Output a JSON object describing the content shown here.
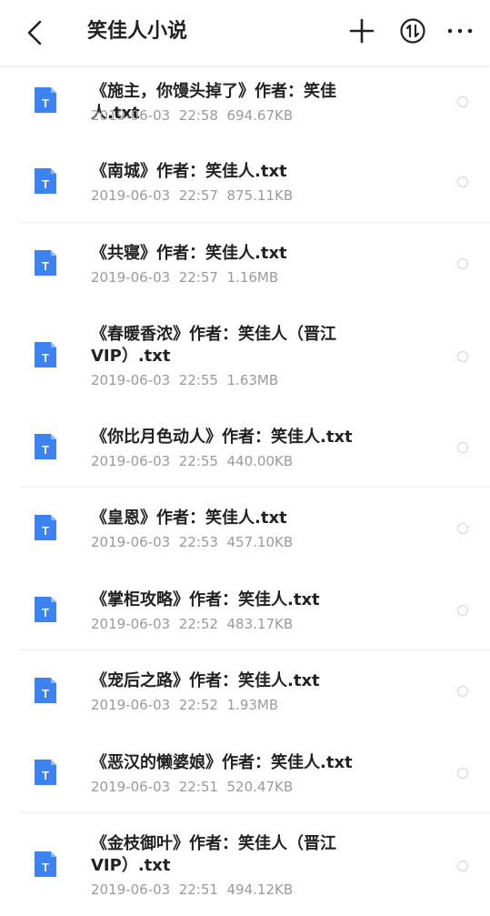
{
  "header": {
    "title": "笑佳人小说",
    "back_icon": "chevron-left-icon",
    "add_icon": "plus-icon",
    "sort_icon": "sort-icon",
    "more_icon": "more-horizontal-icon"
  },
  "accent_color": "#3c82f0",
  "files": [
    {
      "name": "《施主，你馒头掉了》作者：笑佳人.txt",
      "date": "2019-06-03",
      "time": "22:58",
      "size": "694.67KB"
    },
    {
      "name": "《南城》作者：笑佳人.txt",
      "date": "2019-06-03",
      "time": "22:57",
      "size": "875.11KB"
    },
    {
      "name": "《共寝》作者：笑佳人.txt",
      "date": "2019-06-03",
      "time": "22:57",
      "size": "1.16MB"
    },
    {
      "name": "《春暖香浓》作者：笑佳人（晋江VIP）.txt",
      "date": "2019-06-03",
      "time": "22:55",
      "size": "1.63MB"
    },
    {
      "name": "《你比月色动人》作者：笑佳人.txt",
      "date": "2019-06-03",
      "time": "22:55",
      "size": "440.00KB"
    },
    {
      "name": "《皇恩》作者：笑佳人.txt",
      "date": "2019-06-03",
      "time": "22:53",
      "size": "457.10KB"
    },
    {
      "name": "《掌柜攻略》作者：笑佳人.txt",
      "date": "2019-06-03",
      "time": "22:52",
      "size": "483.17KB"
    },
    {
      "name": "《宠后之路》作者：笑佳人.txt",
      "date": "2019-06-03",
      "time": "22:52",
      "size": "1.93MB"
    },
    {
      "name": "《恶汉的懒婆娘》作者：笑佳人.txt",
      "date": "2019-06-03",
      "time": "22:51",
      "size": "520.47KB"
    },
    {
      "name": "《金枝御叶》作者：笑佳人（晋江VIP）.txt",
      "date": "2019-06-03",
      "time": "22:51",
      "size": "494.12KB"
    }
  ]
}
